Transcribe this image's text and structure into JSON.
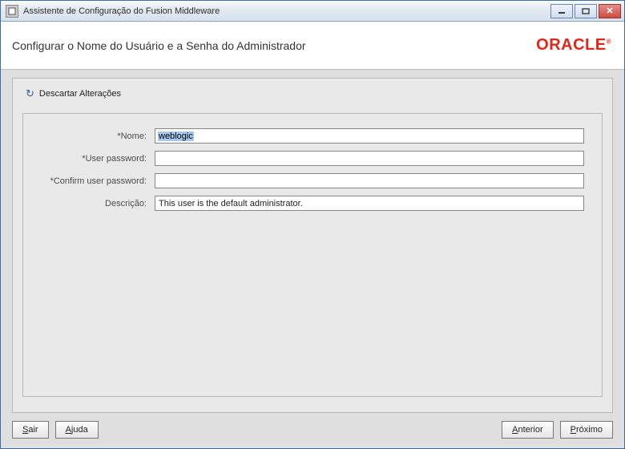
{
  "window": {
    "title": "Assistente de Configuração do Fusion Middleware"
  },
  "header": {
    "title": "Configurar o Nome do Usuário e a Senha do Administrador",
    "logo_text": "ORACLE"
  },
  "discard": {
    "label": "Descartar Alterações"
  },
  "form": {
    "name_label": "*Nome:",
    "name_value": "weblogic",
    "user_password_label": "*User password:",
    "user_password_value": "",
    "confirm_password_label": "*Confirm user password:",
    "confirm_password_value": "",
    "description_label": "Descrição:",
    "description_value": "This user is the default administrator."
  },
  "buttons": {
    "exit": "Sair",
    "exit_u": "S",
    "help": "Ajuda",
    "help_u": "A",
    "prev": "Anterior",
    "prev_u": "A",
    "next": "Próximo",
    "next_u": "P"
  }
}
